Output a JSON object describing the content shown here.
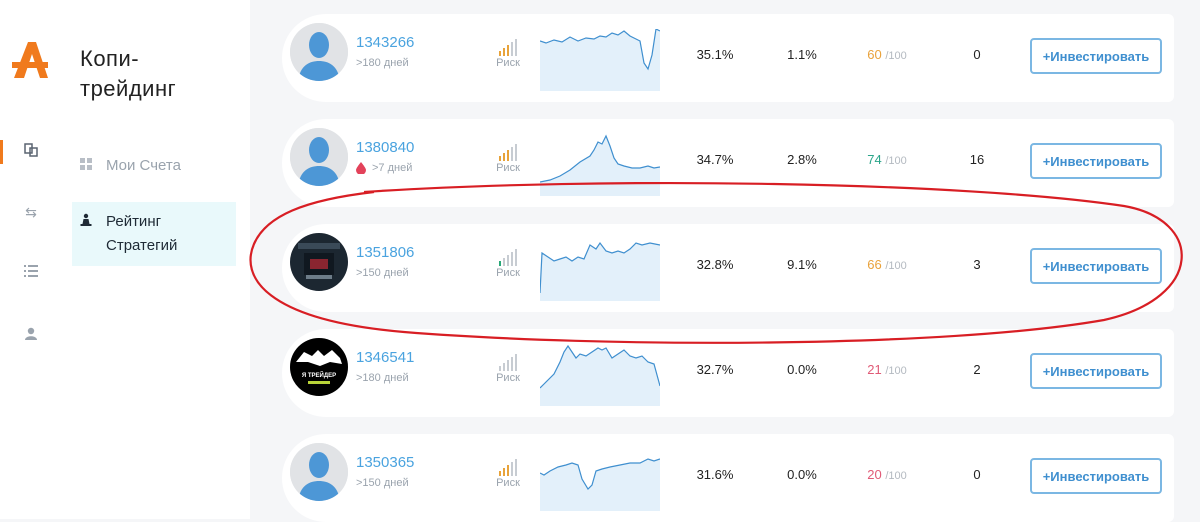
{
  "colors": {
    "accent": "#f07a1d",
    "link": "#4aa3df",
    "button": "#3f8fcf",
    "risk_high": "#e8a33a",
    "risk_low": "#28a877",
    "score_orange": "#e9a23b",
    "score_green": "#2ba58a",
    "score_red": "#e05a76",
    "highlight": "#d81e24"
  },
  "menu": {
    "title": "Копи-трейдинг",
    "items": [
      {
        "label": "Мои Счета",
        "icon": "grid-icon"
      },
      {
        "label": "Рейтинг Стратегий",
        "icon": "chess-pawn-icon"
      }
    ]
  },
  "strategies": [
    {
      "id": "1343266",
      "age": ">180 дней",
      "risk_label": "Риск",
      "risk_level": 3,
      "return": "35.1%",
      "drawdown": "1.1%",
      "score": "60",
      "score_max": "/100",
      "score_color": "orange",
      "investors": "0",
      "invest_label": "+Инвестировать",
      "avatar": "placeholder"
    },
    {
      "id": "1380840",
      "age": ">7 дней",
      "new_badge": "drop-icon",
      "risk_label": "Риск",
      "risk_level": 3,
      "return": "34.7%",
      "drawdown": "2.8%",
      "score": "74",
      "score_max": "/100",
      "score_color": "green",
      "investors": "16",
      "invest_label": "+Инвестировать",
      "avatar": "placeholder"
    },
    {
      "id": "1351806",
      "age": ">150 дней",
      "risk_label": "Риск",
      "risk_level": 1,
      "return": "32.8%",
      "drawdown": "9.1%",
      "score": "66",
      "score_max": "/100",
      "score_color": "orange",
      "investors": "3",
      "invest_label": "+Инвестировать",
      "avatar": "dark-photo"
    },
    {
      "id": "1346541",
      "age": ">180 дней",
      "risk_label": "Риск",
      "risk_level": 0,
      "return": "32.7%",
      "drawdown": "0.0%",
      "score": "21",
      "score_max": "/100",
      "score_color": "red",
      "investors": "2",
      "invest_label": "+Инвестировать",
      "avatar": "bull-bear-logo",
      "avatar_text": "Я ТРЕЙДЕР"
    },
    {
      "id": "1350365",
      "age": ">150 дней",
      "risk_label": "Риск",
      "risk_level": 3,
      "return": "31.6%",
      "drawdown": "0.0%",
      "score": "20",
      "score_max": "/100",
      "score_color": "red",
      "investors": "0",
      "invest_label": "+Инвестировать",
      "avatar": "placeholder"
    }
  ]
}
